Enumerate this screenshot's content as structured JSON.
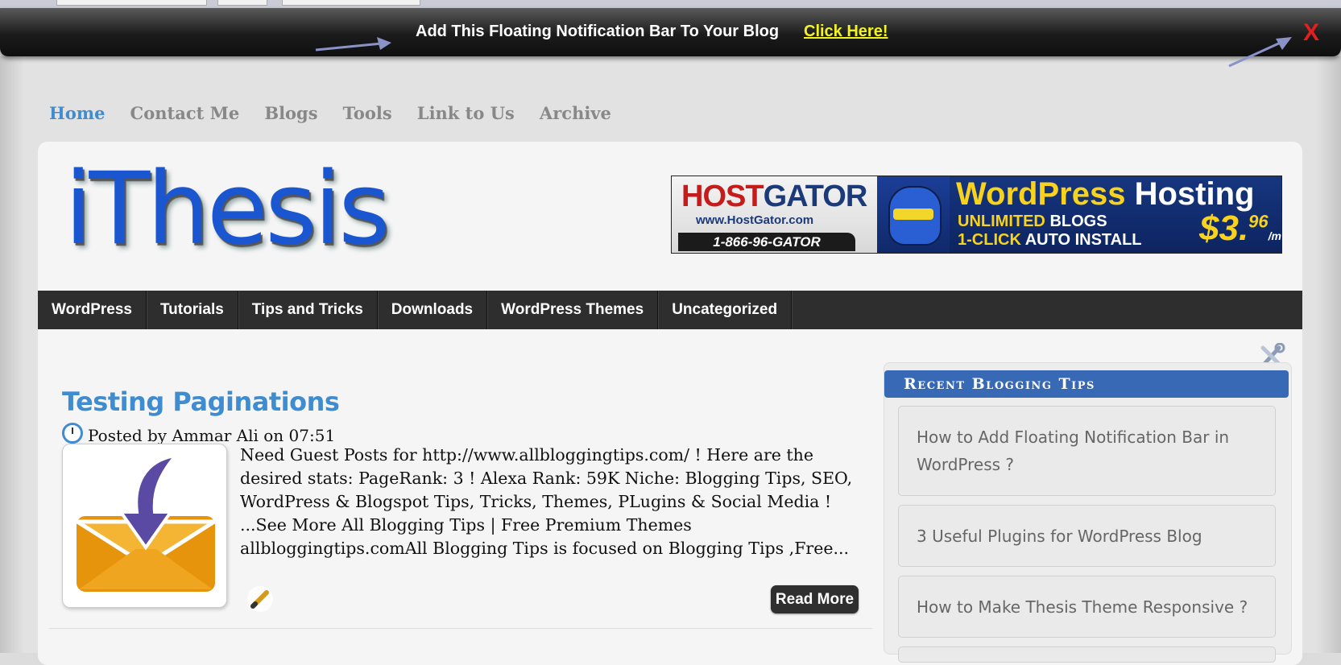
{
  "notification": {
    "text": "Add This Floating Notification Bar To Your Blog",
    "link_label": "Click Here!",
    "close_label": "X"
  },
  "top_nav": {
    "items": [
      {
        "label": "Home",
        "active": true
      },
      {
        "label": "Contact Me"
      },
      {
        "label": "Blogs"
      },
      {
        "label": "Tools"
      },
      {
        "label": "Link to Us"
      },
      {
        "label": "Archive"
      }
    ]
  },
  "site": {
    "logo": "iThesis"
  },
  "banner": {
    "brand_red": "HOST",
    "brand_blue": "GATOR",
    "url": "www.HostGator.com",
    "phone": "1-866-96-GATOR",
    "headline_yellow": "WordPress",
    "headline_white": "Hosting",
    "unlimited_yellow": "UNLIMITED",
    "unlimited_white": "BLOGS",
    "click_yellow": "1-CLICK",
    "click_white": "AUTO INSTALL",
    "price": "$3.",
    "price_cents": "96",
    "price_unit": "/mo"
  },
  "categories": [
    "WordPress",
    "Tutorials",
    "Tips and Tricks",
    "Downloads",
    "WordPress Themes",
    "Uncategorized"
  ],
  "post": {
    "title": "Testing Paginations",
    "posted_by": "Posted by",
    "author": "Ammar Ali",
    "on": "on",
    "time": "07:51",
    "excerpt": "Need Guest Posts for http://www.allbloggingtips.com/ ! Here are the desired stats: PageRank: 3 ! Alexa Rank: 59K Niche: Blogging Tips, SEO, WordPress & Blogspot Tips, Tricks, Themes, PLugins & Social Media ! ...See More All Blogging Tips | Free Premium Themes allbloggingtips.comAll Blogging Tips is focused on Blogging Tips ,Free...",
    "read_more": "Read More"
  },
  "sidebar": {
    "widget_title": "Recent Blogging Tips",
    "items": [
      "How to Add Floating Notification Bar in WordPress ?",
      "3 Useful Plugins for WordPress Blog",
      "How to Make Thesis Theme Responsive ?"
    ]
  },
  "colors": {
    "accent": "#3f8cd0",
    "widget_header": "#3869b5",
    "nav_bar": "#2e2e2e",
    "notification_link": "#f3f320",
    "close": "#e02020"
  }
}
